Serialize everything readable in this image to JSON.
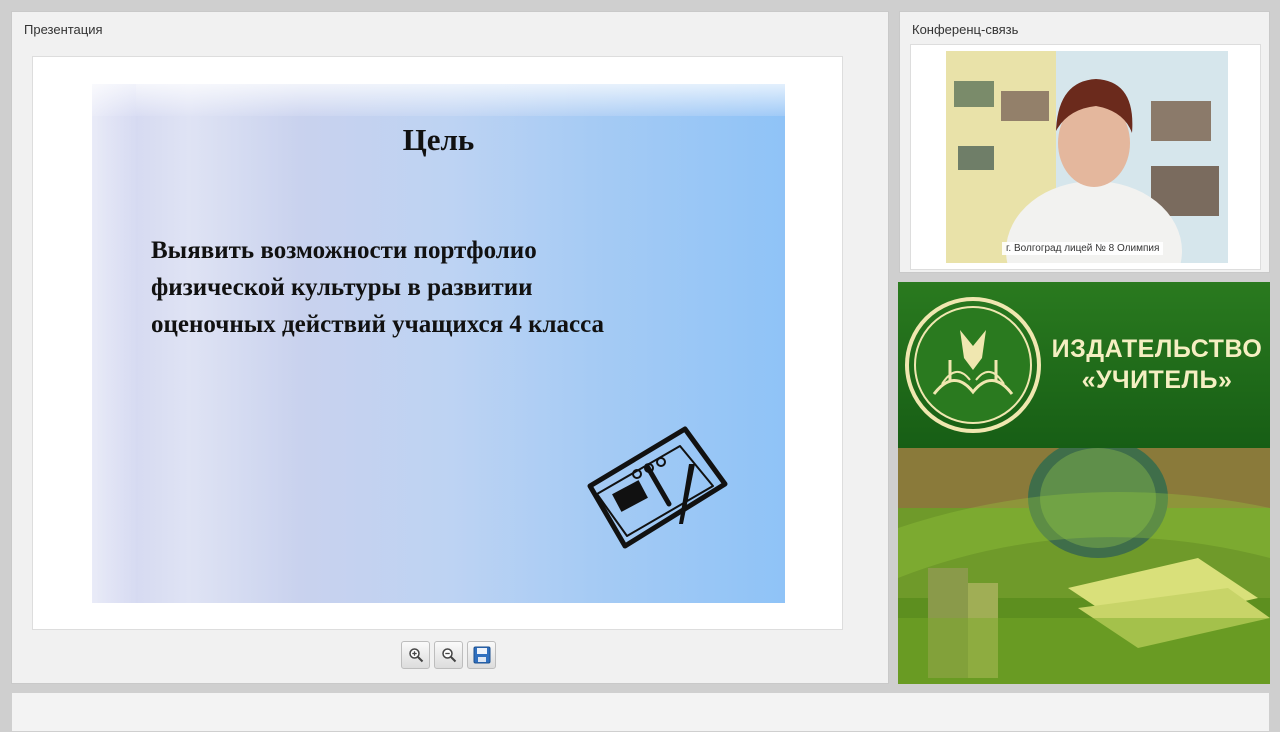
{
  "presentation": {
    "panel_title": "Презентация",
    "slide": {
      "heading": "Цель",
      "body_lines": [
        "Выявить возможности  портфолио",
        "физической культуры в развитии",
        "оценочных действий учащихся 4 класса"
      ]
    },
    "toolbar": {
      "zoom_in_icon": "zoom-in-icon",
      "zoom_out_icon": "zoom-out-icon",
      "save_icon": "save-icon"
    }
  },
  "conference": {
    "panel_title": "Конференц-связь",
    "video_caption": "г. Волгоград лицей № 8 Олимпия"
  },
  "ad": {
    "line1": "ИЗДАТЕЛЬСТВО",
    "line2": "«УЧИТЕЛЬ»"
  },
  "colors": {
    "ad_green": "#1f6b1f",
    "ad_text": "#f5efc2"
  }
}
